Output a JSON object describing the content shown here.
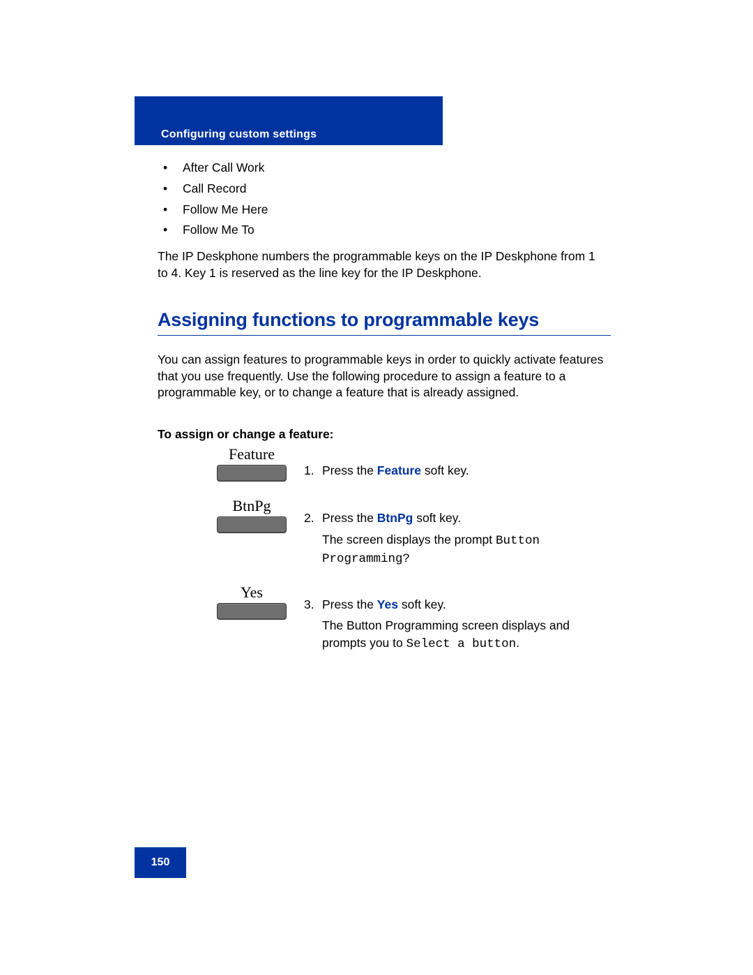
{
  "header": {
    "section_title": "Configuring custom settings"
  },
  "bullets": [
    "After Call Work",
    "Call Record",
    "Follow Me Here",
    "Follow Me To"
  ],
  "paragraph1": "The IP Deskphone numbers the programmable keys on the IP Deskphone from 1 to 4. Key 1 is reserved as the line key for the IP Deskphone.",
  "heading2": "Assigning functions to programmable keys",
  "paragraph2": "You can assign features to programmable keys in order to quickly activate features that you use frequently. Use the following procedure to assign a feature to a programmable key, or to change a feature that is already assigned.",
  "procedure_title": "To assign or change a feature:",
  "steps": [
    {
      "softkey": "Feature",
      "num": "1.",
      "pre": "Press the ",
      "kw": "Feature",
      "post": " soft key."
    },
    {
      "softkey": "BtnPg",
      "num": "2.",
      "pre": "Press the ",
      "kw": "BtnPg",
      "post": " soft key.",
      "sub_pre": "The screen displays the prompt ",
      "sub_mono": "Button Programming?"
    },
    {
      "softkey": "Yes",
      "num": "3.",
      "pre": "Press the ",
      "kw": "Yes",
      "post": " soft key.",
      "sub_pre": "The Button Programming screen displays and prompts you to ",
      "sub_mono": "Select a button",
      "sub_post": "."
    }
  ],
  "page_number": "150"
}
